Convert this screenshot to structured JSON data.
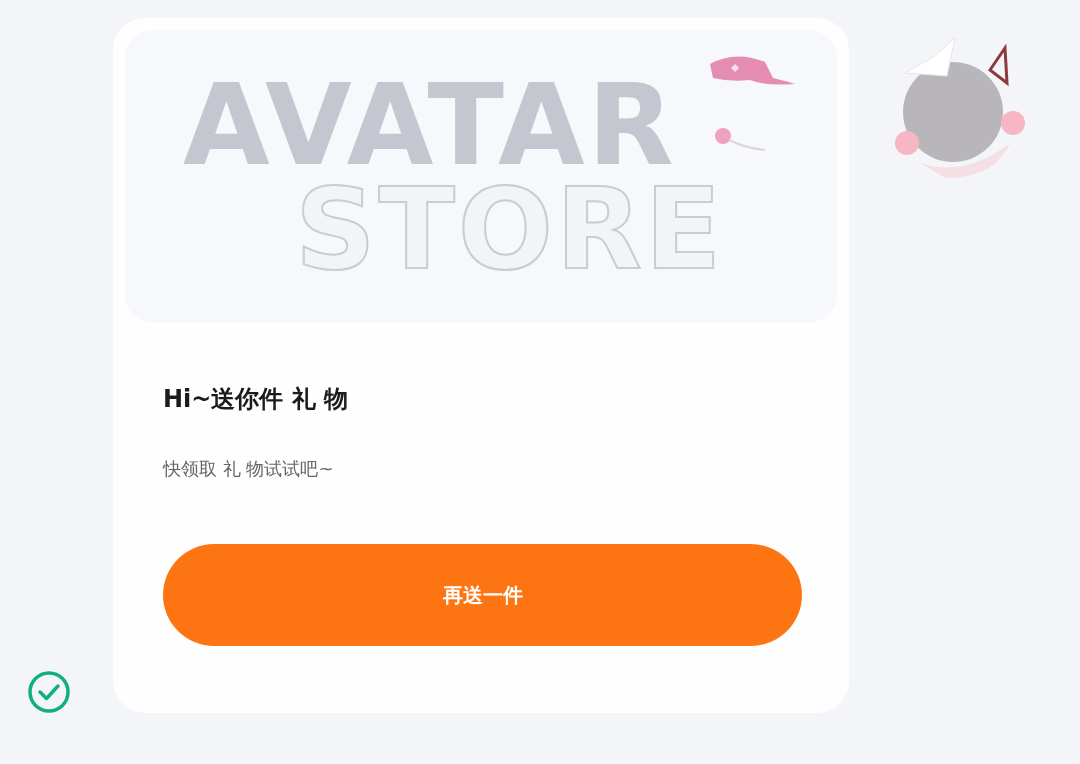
{
  "hero": {
    "words": [
      "AVATAR",
      "STORE"
    ]
  },
  "gift": {
    "title": "Hi~送你件 礼 物",
    "subtitle": "快领取 礼 物试试吧~"
  },
  "button": {
    "label": "再送一件"
  }
}
